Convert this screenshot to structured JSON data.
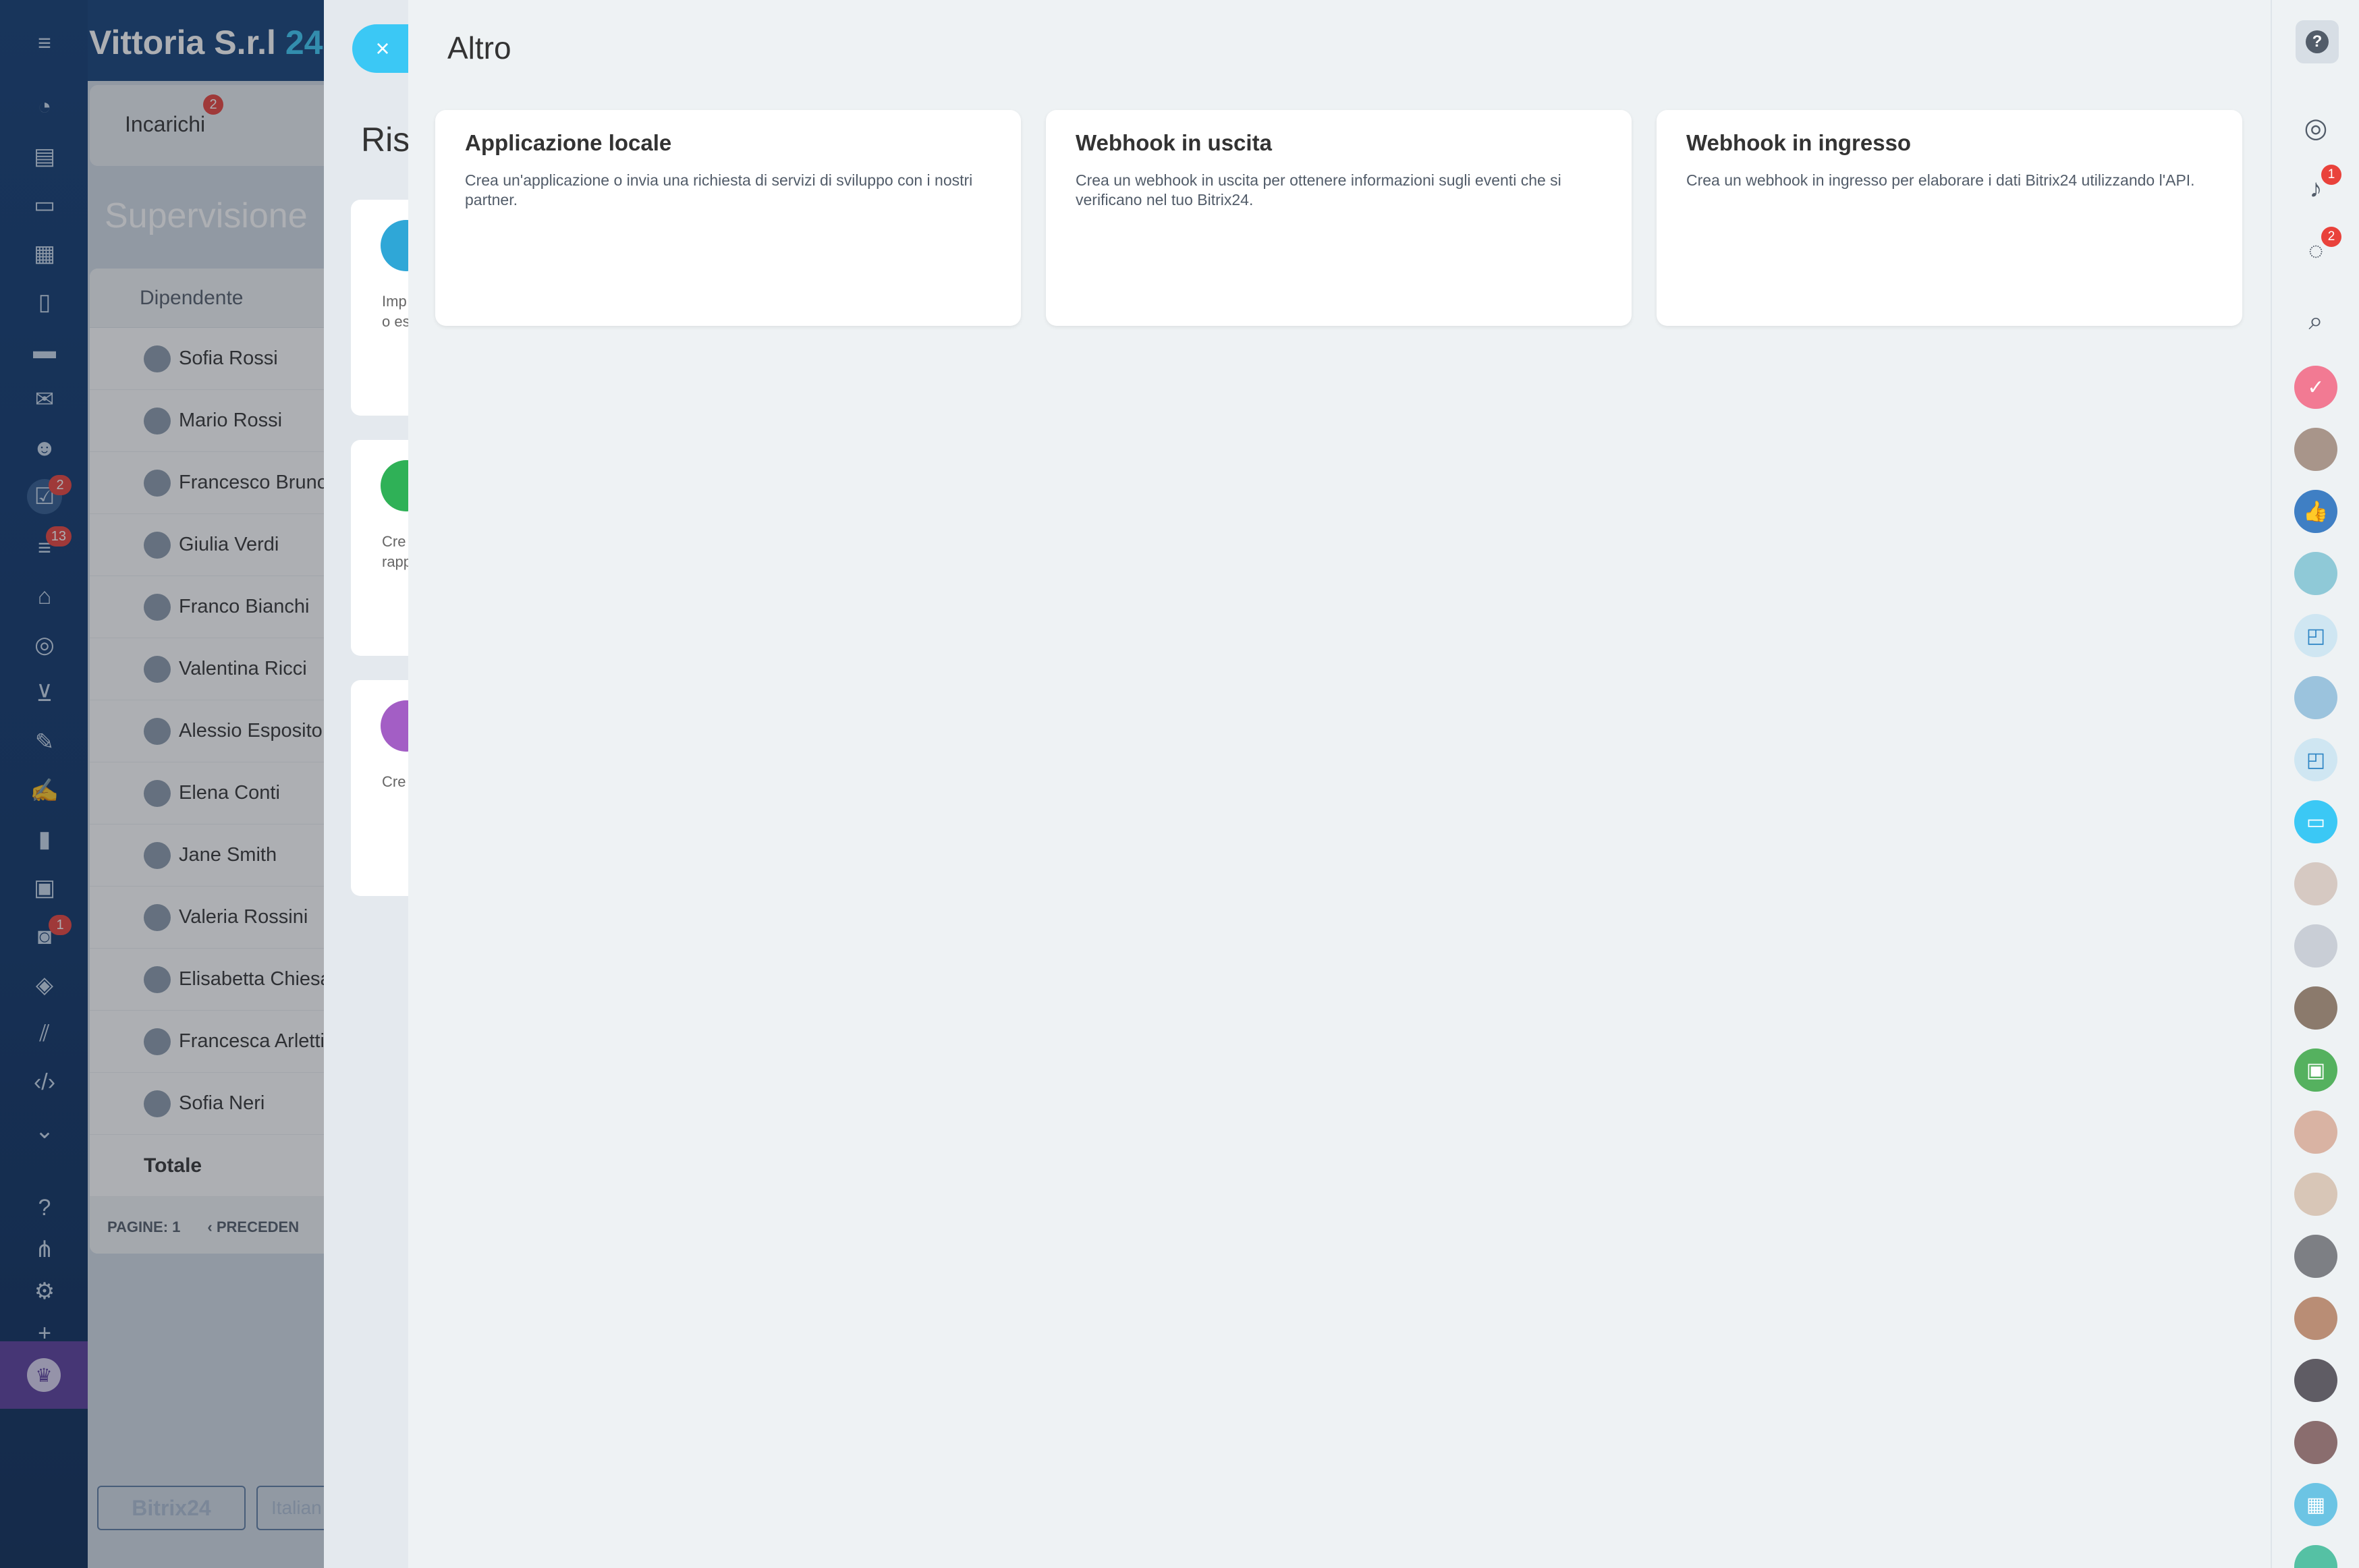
{
  "background_app": {
    "portal_name": "Vittoria S.r.l",
    "portal_suffix": "24",
    "tab_label": "Incarichi",
    "tab_badge": "2",
    "page_title": "Supervisione",
    "table_header": "Dipendente",
    "employees": [
      "Sofia Rossi",
      "Mario Rossi",
      "Francesco Bruno",
      "Giulia Verdi",
      "Franco Bianchi",
      "Valentina Ricci",
      "Alessio Esposito",
      "Elena Conti",
      "Jane Smith",
      "Valeria Rossini",
      "Elisabetta Chiesa",
      "Francesca Arletti",
      "Sofia Neri"
    ],
    "total_label": "Totale",
    "pages_label": "PAGINE:",
    "pages_value": "1",
    "prev_label": "PRECEDEN",
    "footer_brand": "Bitrix24",
    "footer_lang": "Italian"
  },
  "left_nav": {
    "badges": {
      "tasks": "2",
      "crm": "13",
      "robots": "1"
    }
  },
  "middle_panel": {
    "title": "Ris",
    "card_texts": [
      [
        "Imp",
        "o es"
      ],
      [
        "Cre",
        "rapp"
      ],
      [
        "Cre"
      ]
    ]
  },
  "slider": {
    "title": "Altro",
    "close_symbol": "×",
    "cards": [
      {
        "title": "Applicazione locale",
        "desc": "Crea un'applicazione o invia una richiesta di servizi di sviluppo con i nostri partner."
      },
      {
        "title": "Webhook in uscita",
        "desc": "Crea un webhook in uscita per ottenere informazioni sugli eventi che si verificano nel tuo Bitrix24."
      },
      {
        "title": "Webhook in ingresso",
        "desc": "Crea un webhook in ingresso per elaborare i dati Bitrix24 utilizzando l'API."
      }
    ]
  },
  "right_bar": {
    "help_symbol": "?",
    "notifications_badge": "1",
    "chat_badge": "2"
  }
}
